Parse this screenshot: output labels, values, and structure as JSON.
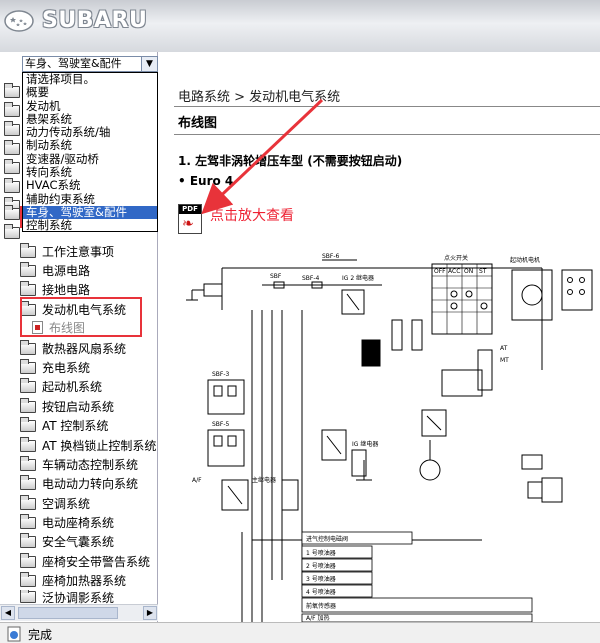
{
  "header": {
    "brand": "SUBARU"
  },
  "dropdown": {
    "selected": "车身、驾驶室&配件",
    "options": [
      "请选择项目。",
      "概要",
      "发动机",
      "悬架系统",
      "动力传动系统/轴",
      "制动系统",
      "变速器/驱动桥",
      "转向系统",
      "HVAC系统",
      "辅助约束系统",
      "车身、驾驶室&配件",
      "控制系统"
    ],
    "highlighted_index": 10
  },
  "tree": {
    "items": [
      {
        "label": "工作注意事项",
        "type": "folder"
      },
      {
        "label": "电源电路",
        "type": "folder"
      },
      {
        "label": "接地电路",
        "type": "folder"
      },
      {
        "label": "发动机电气系统",
        "type": "folder"
      },
      {
        "label": "布线图",
        "type": "doc"
      },
      {
        "label": "散热器风扇系统",
        "type": "folder"
      },
      {
        "label": "充电系统",
        "type": "folder"
      },
      {
        "label": "起动机系统",
        "type": "folder"
      },
      {
        "label": "按钮启动系统",
        "type": "folder"
      },
      {
        "label": "AT 控制系统",
        "type": "folder"
      },
      {
        "label": "AT 换档锁止控制系统",
        "type": "folder"
      },
      {
        "label": "车辆动态控制系统",
        "type": "folder"
      },
      {
        "label": "电动动力转向系统",
        "type": "folder"
      },
      {
        "label": "空调系统",
        "type": "folder"
      },
      {
        "label": "电动座椅系统",
        "type": "folder"
      },
      {
        "label": "安全气囊系统",
        "type": "folder"
      },
      {
        "label": "座椅安全带警告系统",
        "type": "folder"
      },
      {
        "label": "座椅加热器系统",
        "type": "folder"
      },
      {
        "label": "泛协调影系统",
        "type": "folder"
      }
    ]
  },
  "main": {
    "breadcrumb": "电路系统 > 发动机电气系统",
    "section_title": "布线图",
    "heading": "1.  左驾非涡轮增压车型 (不需要按钮启动)",
    "bullet": "• Euro 4",
    "pdf_label": "PDF",
    "zoom_hint": "点击放大查看"
  },
  "diagram": {
    "labels": [
      "SBF",
      "SBF-6",
      "SBF-4",
      "IG 2 继电器",
      "点火开关",
      "OFF",
      "ACC",
      "ON",
      "ST",
      "起动机电机",
      "SBF-3",
      "SBF-5",
      "AT",
      "MT",
      "IG 继电器",
      "A/F",
      "主继电器"
    ],
    "rows": [
      "进气控制电磁阀",
      "1 号喷油器",
      "2 号喷油器",
      "3 号喷油器",
      "4 号喷油器",
      "前氧传感器",
      "A/F 加热"
    ]
  },
  "status": {
    "text": "完成"
  },
  "colors": {
    "accent": "#e8333a",
    "selection": "#3168c6"
  }
}
